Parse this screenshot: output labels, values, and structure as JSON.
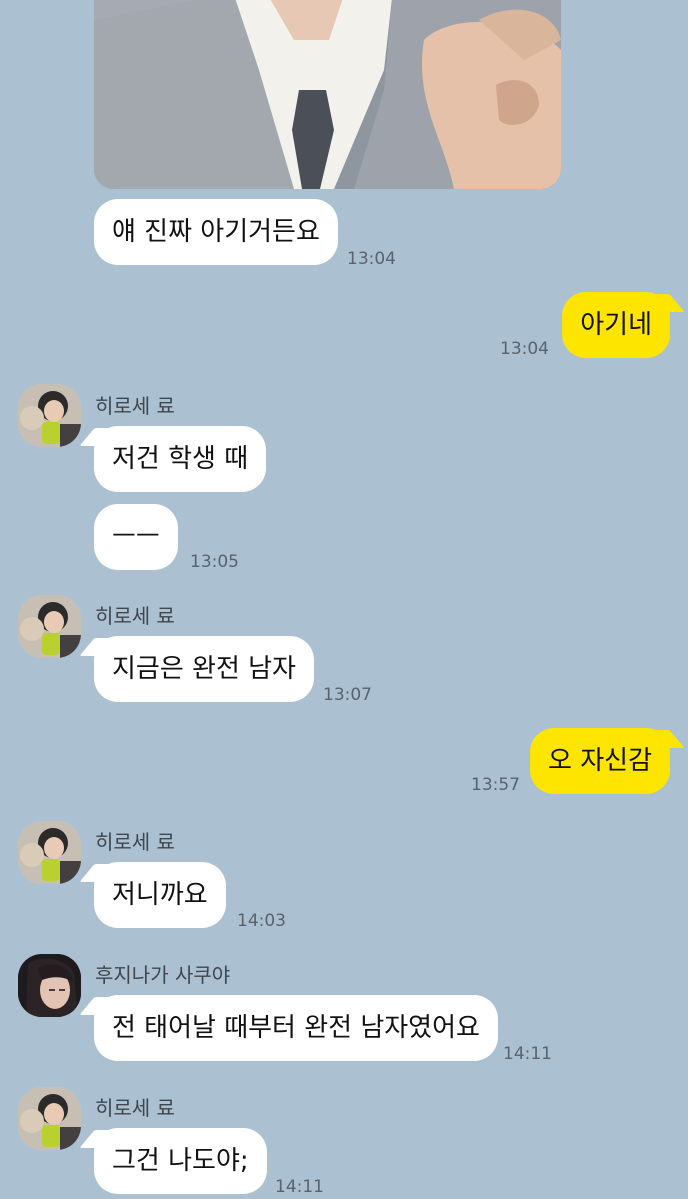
{
  "chat": {
    "messages": [
      {
        "from": "other",
        "text": "얘 진짜 아기거든요",
        "time": "13:04"
      },
      {
        "from": "me",
        "text": "아기네",
        "time": "13:04"
      },
      {
        "from": "other",
        "sender": "히로세 료",
        "text": "저건 학생 때"
      },
      {
        "from": "other",
        "text": "ㅡㅡ",
        "time": "13:05"
      },
      {
        "from": "other",
        "sender": "히로세 료",
        "text": "지금은 완전 남자",
        "time": "13:07"
      },
      {
        "from": "me",
        "text": "오 자신감",
        "time": "13:57"
      },
      {
        "from": "other",
        "sender": "히로세 료",
        "text": "저니까요",
        "time": "14:03"
      },
      {
        "from": "other",
        "sender": "후지나가 사쿠야",
        "text": "전 태어날 때부터 완전 남자였어요",
        "time": "14:11"
      },
      {
        "from": "other",
        "sender": "히로세 료",
        "text": "그건 나도야;",
        "time": "14:11"
      }
    ]
  },
  "colors": {
    "background": "#abc1d1",
    "incoming_bubble": "#ffffff",
    "outgoing_bubble": "#fee500"
  },
  "icons": {
    "shared_photo": "photo-thumbnail",
    "hirose_avatar": "profile-photo",
    "fujinaga_avatar": "profile-photo"
  }
}
